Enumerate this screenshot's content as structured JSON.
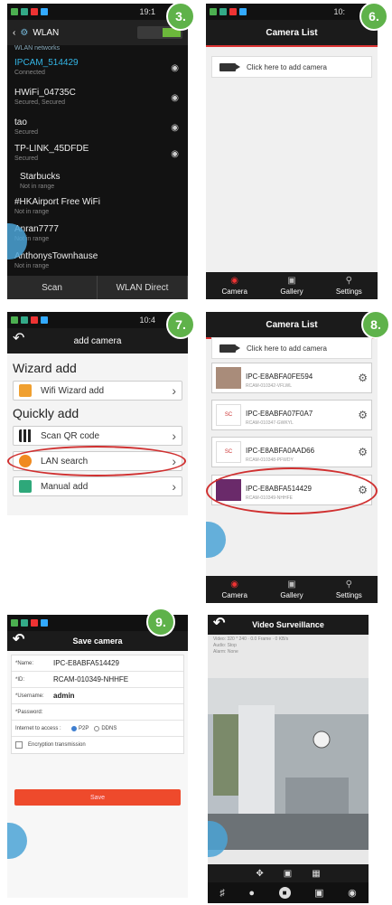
{
  "steps": {
    "s3": "3.",
    "s6": "6.",
    "s7": "7.",
    "s8": "8.",
    "s9": "9."
  },
  "wlan": {
    "status_time": "19:1",
    "title": "WLAN",
    "subtitle": "WLAN networks",
    "networks": [
      {
        "name": "IPCAM_514429",
        "status": "Connected"
      },
      {
        "name": "HWiFi_04735C",
        "status": "Secured, Secured"
      },
      {
        "name": "tao",
        "status": "Secured"
      },
      {
        "name": "TP-LINK_45DFDE",
        "status": "Secured"
      },
      {
        "name": "Starbucks",
        "status": "Not in range"
      },
      {
        "name": "#HKAirport Free WiFi",
        "status": "Not in range"
      },
      {
        "name": "Anran7777",
        "status": "Not in range"
      },
      {
        "name": "AnthonysTownhause",
        "status": "Not in range"
      }
    ],
    "footer": {
      "scan": "Scan",
      "direct": "WLAN Direct"
    }
  },
  "camlist_empty": {
    "status_time": "10:",
    "title": "Camera List",
    "add_text": "Click here to add camera",
    "tabs": [
      "Camera",
      "Gallery",
      "Settings"
    ]
  },
  "add_camera": {
    "status_time": "10:4",
    "title": "add camera",
    "wizard_heading": "Wizard add",
    "wizard_item": "Wifi Wizard add",
    "quick_heading": "Quickly add",
    "items": [
      "Scan QR code",
      "LAN search",
      "Manual add"
    ]
  },
  "camlist_full": {
    "title": "Camera List",
    "add_text": "Click here to add camera",
    "cameras": [
      {
        "name": "IPC-E8ABFA0FE594",
        "uid": "RCAM-010342-VFLWL"
      },
      {
        "name": "IPC-E8ABFA07F0A7",
        "uid": "RCAM-010347-GWKYL"
      },
      {
        "name": "IPC-E8ABFA0AAD66",
        "uid": "RCAM-010348-PFWDY"
      },
      {
        "name": "IPC-E8ABFA514429",
        "uid": "RCAM-010349-NHHFE"
      }
    ],
    "tabs": [
      "Camera",
      "Gallery",
      "Settings"
    ]
  },
  "save_camera": {
    "title": "Save camera",
    "name_label": "*Name:",
    "name_value": "IPC-E8ABFA514429",
    "id_label": "*ID:",
    "id_value": "RCAM-010349-NHHFE",
    "user_label": "*Username:",
    "user_value": "admin",
    "pass_label": "*Password:",
    "access_label": "Internet to access :",
    "p2p": "P2P",
    "ddns": "DDNS",
    "encryption": "Encryption transmission",
    "save": "Save"
  },
  "video": {
    "title": "Video Surveillance",
    "info_lines": [
      "Video: 320 * 240 · 0.0 Frame · 0 KB/s",
      "Audio: Stop",
      "Alarm: None"
    ]
  },
  "colors": {
    "accent_green": "#5fb24a",
    "highlight_red": "#d03030",
    "save_red": "#ee4a2c",
    "wifi_blue": "#33b5e5"
  }
}
